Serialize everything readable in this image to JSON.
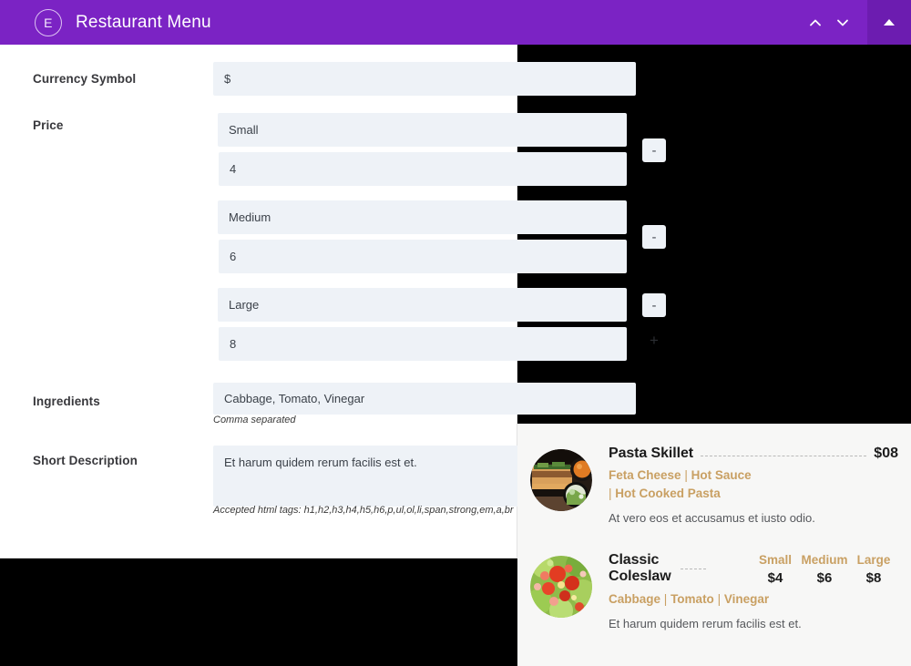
{
  "window": {
    "title": "Restaurant Menu",
    "brand_initial": "E",
    "accent_purple": "#7b23c4",
    "accent_purple_dark": "#6c1cb0",
    "controls": {
      "chevron_up": "chevron-up",
      "chevron_down": "chevron-down",
      "collapse": "triangle-up"
    }
  },
  "form": {
    "fields": [
      {
        "label": "Currency Symbol",
        "value": "$"
      },
      {
        "label": "Price"
      },
      {
        "label": "Ingredients",
        "value": "Cabbage, Tomato, Vinegar",
        "helper": "Comma separated"
      },
      {
        "label": "Short Description",
        "value": "Et harum quidem rerum facilis est et.",
        "helper": "Accepted html tags: h1,h2,h3,h4,h5,h6,p,ul,ol,li,span,strong,em,a,br"
      }
    ],
    "price_rows": [
      {
        "size": "Small",
        "amount": "4",
        "remove": "-"
      },
      {
        "size": "Medium",
        "amount": "6",
        "remove": "-"
      },
      {
        "size": "Large",
        "amount": "8",
        "remove": "-"
      }
    ],
    "add_row_label": "+"
  },
  "preview": {
    "items": [
      {
        "name": "Pasta Skillet",
        "price": "$08",
        "thumb": "pasta-skillet-photo",
        "ingredients": [
          "Feta Cheese",
          "Hot Sauce",
          "Hot Cooked Pasta"
        ],
        "description": "At vero eos et accusamus et iusto odio.",
        "ingredient_color": "#c9a063"
      },
      {
        "name": "Classic Coleslaw",
        "name_line1": "Classic",
        "name_line2": "Coleslaw",
        "thumb": "classic-coleslaw-photo",
        "sizes": [
          {
            "label": "Small",
            "price": "$4"
          },
          {
            "label": "Medium",
            "price": "$6"
          },
          {
            "label": "Large",
            "price": "$8"
          }
        ],
        "ingredients": [
          "Cabbage",
          "Tomato",
          "Vinegar"
        ],
        "description": "Et harum quidem rerum facilis est et.",
        "ingredient_color": "#c9a063"
      }
    ],
    "separator": "|"
  }
}
